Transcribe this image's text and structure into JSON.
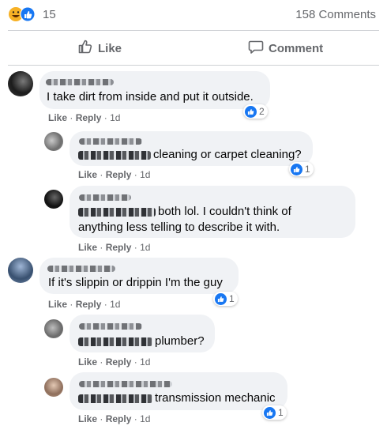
{
  "reactions": {
    "count": "15",
    "comments": "158 Comments"
  },
  "actions": {
    "like": "Like",
    "comment": "Comment"
  },
  "comment_meta": {
    "like": "Like",
    "sep": "·",
    "reply": "Reply"
  },
  "comments": [
    {
      "text": "I take dirt from inside and put it outside.",
      "time": "1d",
      "reactions": "2"
    },
    {
      "text": "cleaning or carpet cleaning?",
      "time": "1d",
      "reactions": "1"
    },
    {
      "text": "both lol. I couldn't think of",
      "text2": "anything less telling to describe it with.",
      "time": "1d"
    },
    {
      "text": "If it's slippin or drippin I'm the guy",
      "time": "1d",
      "reactions": "1"
    },
    {
      "text": "plumber?",
      "time": "1d"
    },
    {
      "text": "transmission mechanic",
      "time": "1d",
      "reactions": "1"
    }
  ],
  "colors": {
    "like_blue": "#1877f2",
    "bubble": "#f0f2f5",
    "secondary_text": "#65676b"
  }
}
